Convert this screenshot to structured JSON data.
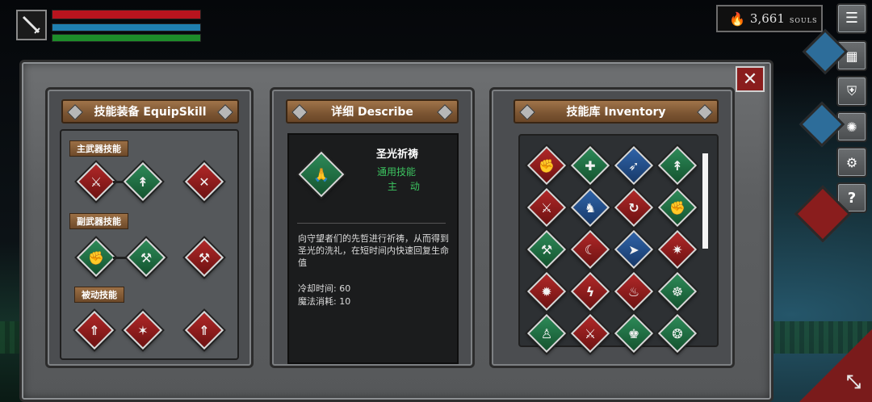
{
  "hud": {
    "health_color": "#b8141e",
    "mana_color": "#1f7fb0",
    "stamina_color": "#1d8c2a",
    "weapon_icon": "sword-icon"
  },
  "souls": {
    "count": "3,661",
    "label": "SOULS",
    "icon": "flame-icon"
  },
  "menu": {
    "buttons": [
      "menu-list-icon",
      "map-icon",
      "armor-icon",
      "settings-gear-icon",
      "help-icon"
    ],
    "help_label": "?"
  },
  "equip": {
    "title": "技能装备 EquipSkill",
    "main_weapon_label": "主武器技能",
    "sub_weapon_label": "副武器技能",
    "passive_label": "被动技能"
  },
  "describe": {
    "title": "详细 Describe",
    "skill_name": "圣光祈祷",
    "skill_type": "通用技能",
    "skill_mode": "主 动",
    "description": "向守望者们的先哲进行祈祷，从而得到圣光的洗礼，在短时间内快速回复生命值",
    "cooldown": "冷却时间: 60",
    "mana_cost": "魔法消耗: 10"
  },
  "inventory": {
    "title": "技能库 Inventory"
  },
  "close_label": "✕"
}
